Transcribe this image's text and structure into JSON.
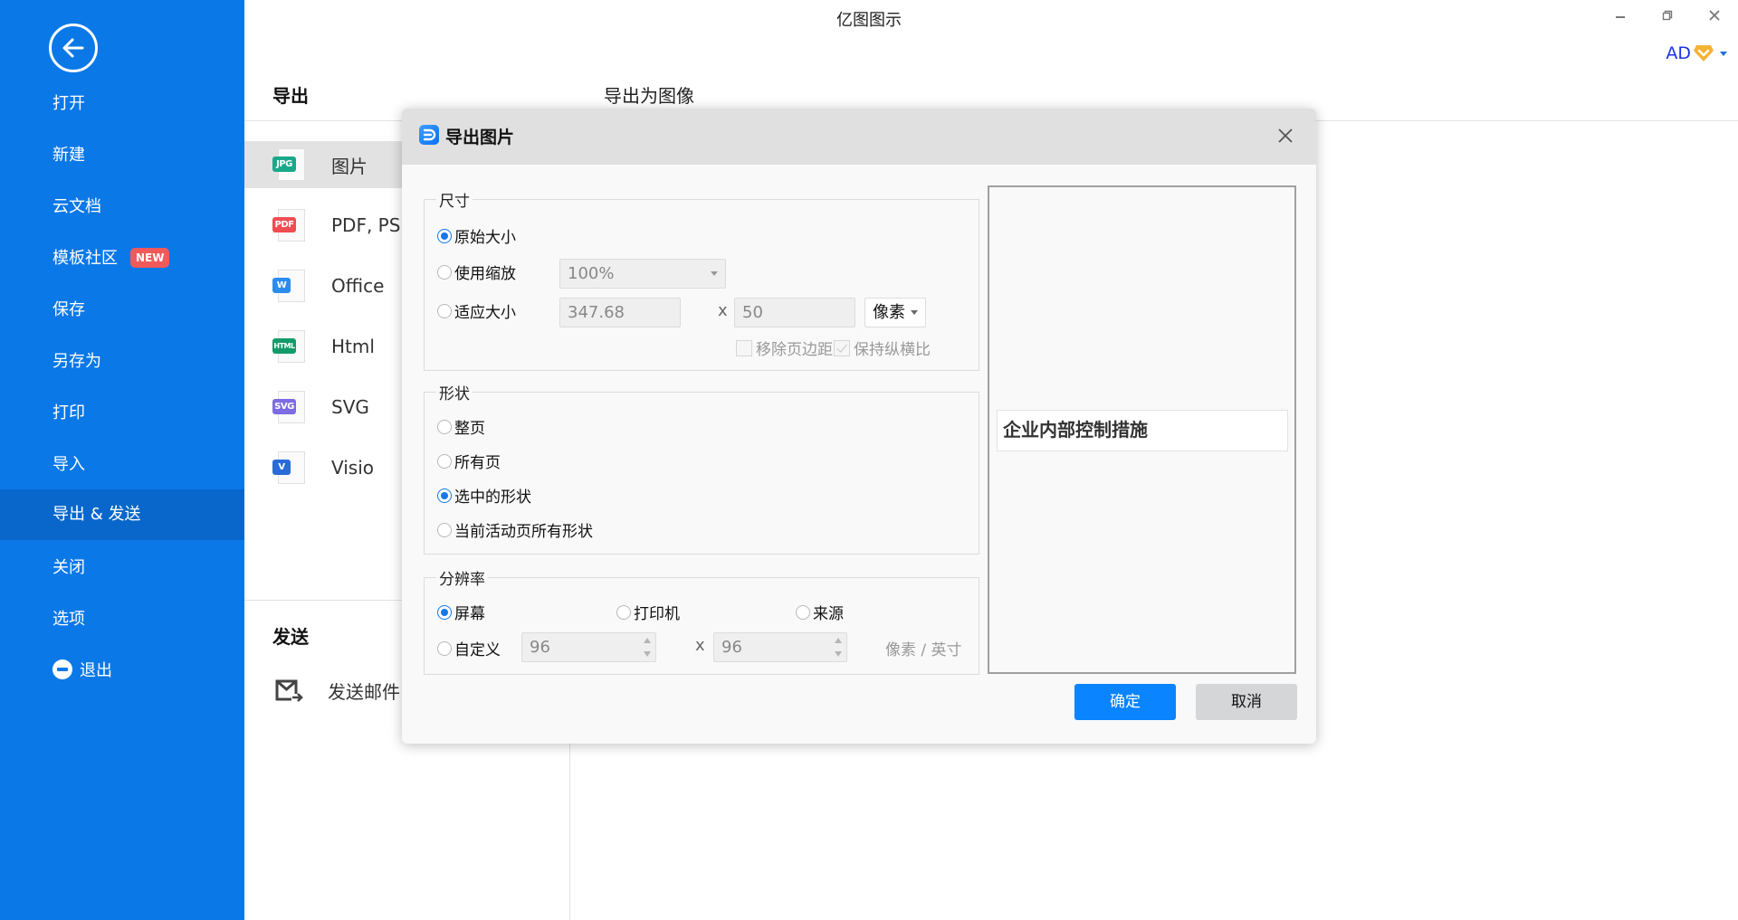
{
  "app": {
    "title": "亿图图示",
    "user_initials": "AD",
    "window_controls": [
      "minimize-icon",
      "restore-icon",
      "close-icon"
    ]
  },
  "sidebar": {
    "back_icon": "arrow-left-circle-icon",
    "items": [
      {
        "label": "打开"
      },
      {
        "label": "新建"
      },
      {
        "label": "云文档"
      },
      {
        "label": "模板社区",
        "badge": "NEW"
      },
      {
        "label": "保存"
      },
      {
        "label": "另存为"
      },
      {
        "label": "打印"
      },
      {
        "label": "导入"
      },
      {
        "label": "导出 & 发送",
        "active": true
      },
      {
        "label": "关闭"
      },
      {
        "label": "选项"
      },
      {
        "label": "退出",
        "icon": "minus-circle-icon"
      }
    ]
  },
  "export_panel": {
    "section_title": "导出",
    "right_heading": "导出为图像",
    "items": [
      {
        "label": "图片",
        "tag": "JPG",
        "color": "#1aa88a",
        "active": true
      },
      {
        "label": "PDF, PS, EPS",
        "tag": "PDF",
        "color": "#ef4d52"
      },
      {
        "label": "Office",
        "tag": "W",
        "color": "#2b8cf0"
      },
      {
        "label": "Html",
        "tag": "HTML",
        "color": "#129b6a"
      },
      {
        "label": "SVG",
        "tag": "SVG",
        "color": "#7c6be2"
      },
      {
        "label": "Visio",
        "tag": "V",
        "color": "#2a6bd8"
      }
    ],
    "send_title": "发送",
    "send_items": [
      {
        "label": "发送邮件",
        "icon": "mail-send-icon"
      }
    ]
  },
  "dialog": {
    "title": "导出图片",
    "size_group": {
      "legend": "尺寸",
      "options": [
        "原始大小",
        "使用缩放",
        "适应大小"
      ],
      "selected": "原始大小",
      "zoom_value": "100%",
      "width_value": "347.68",
      "height_value": "50",
      "times": "x",
      "unit_value": "像素",
      "remove_margin_label": "移除页边距",
      "remove_margin_checked": false,
      "keep_ratio_label": "保持纵横比",
      "keep_ratio_checked": true
    },
    "shape_group": {
      "legend": "形状",
      "options": [
        "整页",
        "所有页",
        "选中的形状",
        "当前活动页所有形状"
      ],
      "selected": "选中的形状"
    },
    "resolution_group": {
      "legend": "分辨率",
      "options": [
        "屏幕",
        "打印机",
        "来源",
        "自定义"
      ],
      "selected": "屏幕",
      "dpi_x": "96",
      "dpi_y": "96",
      "times": "x",
      "unit": "像素 / 英寸"
    },
    "preview_text": "企业内部控制措施",
    "ok_label": "确定",
    "cancel_label": "取消"
  }
}
